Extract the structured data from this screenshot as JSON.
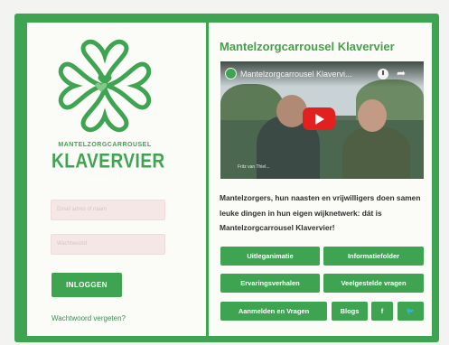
{
  "logo": {
    "subtitle": "MANTELZORGCARROUSEL",
    "title": "KLAVERVIER",
    "tagline": "· · · · · · · · · · ·"
  },
  "login": {
    "username_placeholder": "Email adres of naam",
    "password_placeholder": "Wachtwoord",
    "submit_label": "INLOGGEN",
    "forgot_label": "Wachtwoord vergeten?"
  },
  "content": {
    "title": "Mantelzorgcarrousel Klavervier",
    "video": {
      "title": "Mantelzorgcarrousel Klavervi...",
      "caption": "Fritz van Thiel..."
    },
    "description": "Mantelzorgers, hun naasten en vrijwilligers doen samen leuke dingen in hun eigen wijknetwerk: dát is Mantelzorgcarrousel Klavervier!",
    "buttons": {
      "uitleganimatie": "Uitleganimatie",
      "informatiefolder": "Informatiefolder",
      "ervaringsverhalen": "Ervaringsverhalen",
      "veelgestelde": "Veelgestelde vragen",
      "aanmelden": "Aanmelden en Vragen",
      "blogs": "Blogs",
      "facebook": "f",
      "twitter": "🐦"
    }
  },
  "colors": {
    "brand_green": "#3fa452",
    "background": "#f3f3f1",
    "card": "#fbfbf8"
  }
}
